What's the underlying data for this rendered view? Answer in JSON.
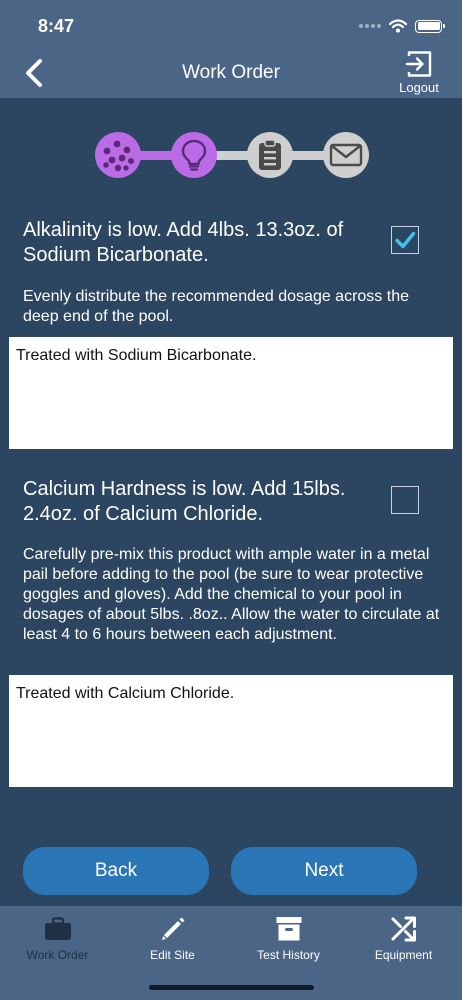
{
  "status_bar": {
    "time": "8:47"
  },
  "header": {
    "title": "Work Order",
    "logout_label": "Logout"
  },
  "stepper": {
    "steps": [
      {
        "icon": "chemicals-icon",
        "state": "active"
      },
      {
        "icon": "lightbulb-icon",
        "state": "active"
      },
      {
        "icon": "clipboard-icon",
        "state": "inactive"
      },
      {
        "icon": "envelope-icon",
        "state": "inactive"
      }
    ],
    "active_color": "#bc6be6",
    "inactive_color": "#cfcfcf"
  },
  "tasks": [
    {
      "title": "Alkalinity is low. Add 4lbs. 13.3oz. of Sodium Bicarbonate.",
      "checked": true,
      "instructions": "Evenly distribute the recommended dosage across the deep end of the pool.",
      "notes": "Treated with Sodium Bicarbonate."
    },
    {
      "title": "Calcium Hardness is low. Add 15lbs. 2.4oz. of Calcium Chloride.",
      "checked": false,
      "instructions": "Carefully pre-mix this product with ample water in a metal pail before adding to the pool (be sure to wear protective goggles and gloves).  Add the chemical to your pool in dosages of about 5lbs. .8oz..  Allow the water to circulate at least 4 to 6 hours between each adjustment.",
      "notes": "Treated with Calcium Chloride."
    }
  ],
  "actions": {
    "back_label": "Back",
    "next_label": "Next"
  },
  "tabbar": {
    "tabs": [
      {
        "label": "Work Order",
        "icon": "briefcase-icon",
        "active": true
      },
      {
        "label": "Edit Site",
        "icon": "pencil-icon",
        "active": false
      },
      {
        "label": "Test History",
        "icon": "archive-box-icon",
        "active": false
      },
      {
        "label": "Equipment",
        "icon": "shuffle-icon",
        "active": false
      }
    ]
  },
  "colors": {
    "header": "#4b6587",
    "background": "#2c4661",
    "button": "#2a76b7",
    "check": "#3fc4f0"
  }
}
